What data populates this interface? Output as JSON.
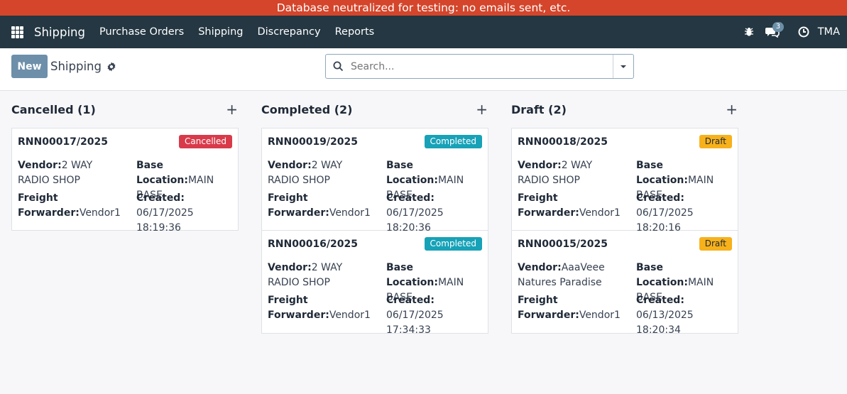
{
  "banner": {
    "text": "Database neutralized for testing: no emails sent, etc."
  },
  "navbar": {
    "app_name": "Shipping",
    "menu": [
      "Purchase Orders",
      "Shipping",
      "Discrepancy",
      "Reports"
    ],
    "message_count": "3",
    "user": "TMA"
  },
  "control": {
    "new_label": "New",
    "breadcrumb": "Shipping",
    "search_placeholder": "Search..."
  },
  "columns": [
    {
      "title": "Cancelled (1)",
      "add": "+",
      "cards": [
        {
          "ref": "RNN00017/2025",
          "status": "Cancelled",
          "vendor_label": "Vendor:",
          "vendor": "2 WAY RADIO SHOP",
          "base_label": "Base Location:",
          "base": "MAIN BASE",
          "freight_label": "Freight Forwarder:",
          "freight": "Vendor1",
          "created_label": "Created:",
          "created": "06/17/2025 18:19:36"
        }
      ]
    },
    {
      "title": "Completed (2)",
      "add": "+",
      "cards": [
        {
          "ref": "RNN00019/2025",
          "status": "Completed",
          "vendor_label": "Vendor:",
          "vendor": "2 WAY RADIO SHOP",
          "base_label": "Base Location:",
          "base": "MAIN BASE",
          "freight_label": "Freight Forwarder:",
          "freight": "Vendor1",
          "created_label": "Created:",
          "created": "06/17/2025 18:20:36"
        },
        {
          "ref": "RNN00016/2025",
          "status": "Completed",
          "vendor_label": "Vendor:",
          "vendor": "2 WAY RADIO SHOP",
          "base_label": "Base Location:",
          "base": "MAIN BASE",
          "freight_label": "Freight Forwarder:",
          "freight": "Vendor1",
          "created_label": "Created:",
          "created": "06/17/2025 17:34:33"
        }
      ]
    },
    {
      "title": "Draft (2)",
      "add": "+",
      "cards": [
        {
          "ref": "RNN00018/2025",
          "status": "Draft",
          "vendor_label": "Vendor:",
          "vendor": "2 WAY RADIO SHOP",
          "base_label": "Base Location:",
          "base": "MAIN BASE",
          "freight_label": "Freight Forwarder:",
          "freight": "Vendor1",
          "created_label": "Created:",
          "created": "06/17/2025 18:20:16"
        },
        {
          "ref": "RNN00015/2025",
          "status": "Draft",
          "vendor_label": "Vendor:",
          "vendor": "AaaVeee Natures Paradise",
          "base_label": "Base Location:",
          "base": "MAIN BASE",
          "freight_label": "Freight Forwarder:",
          "freight": "Vendor1",
          "created_label": "Created:",
          "created": "06/13/2025 18:20:34"
        }
      ]
    }
  ],
  "colors": {
    "banner": "#d4452b",
    "navbar": "#243742",
    "cancelled": "#d93a4a",
    "completed": "#17a2b8",
    "draft": "#f7b11a",
    "new_button": "#6d8faa"
  }
}
